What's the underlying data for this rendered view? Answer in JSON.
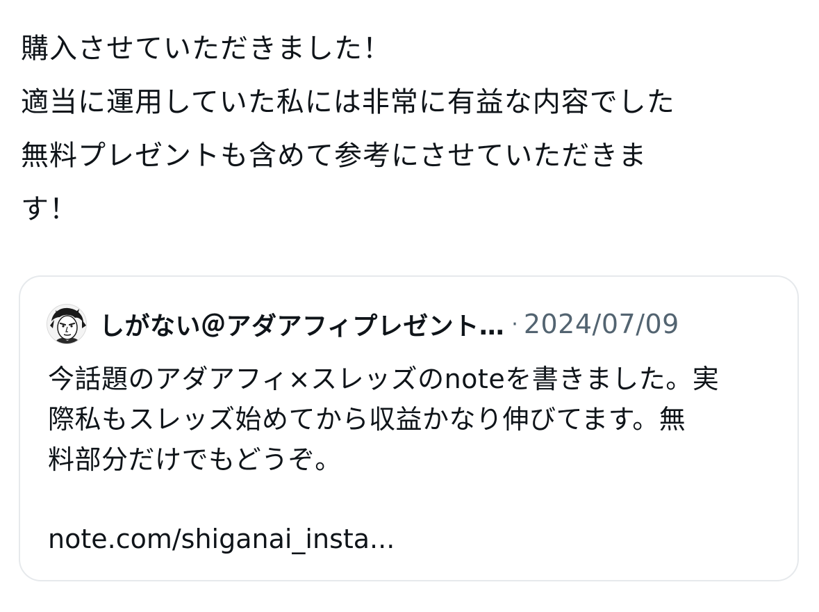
{
  "post": {
    "lines": [
      "購入させていただきました！",
      "適当に運用していた私には非常に有益な内容でした",
      "無料プレゼントも含めて参考にさせていただきま",
      "す！"
    ]
  },
  "quote": {
    "author": "しがない＠アダアフィプレゼント…",
    "separator": "·",
    "date": "2024/07/09",
    "avatar_icon": "avatar-manga-portrait",
    "body_lines": [
      "今話題のアダアフィ×スレッズのnoteを書きました。実",
      "際私もスレッズ始めてから収益かなり伸びてます。無",
      "料部分だけでもどうぞ。"
    ],
    "link": "note.com/shiganai_insta..."
  },
  "colors": {
    "text": "#0f1419",
    "secondary": "#536471",
    "border": "#e6e9ec",
    "background": "#ffffff"
  }
}
